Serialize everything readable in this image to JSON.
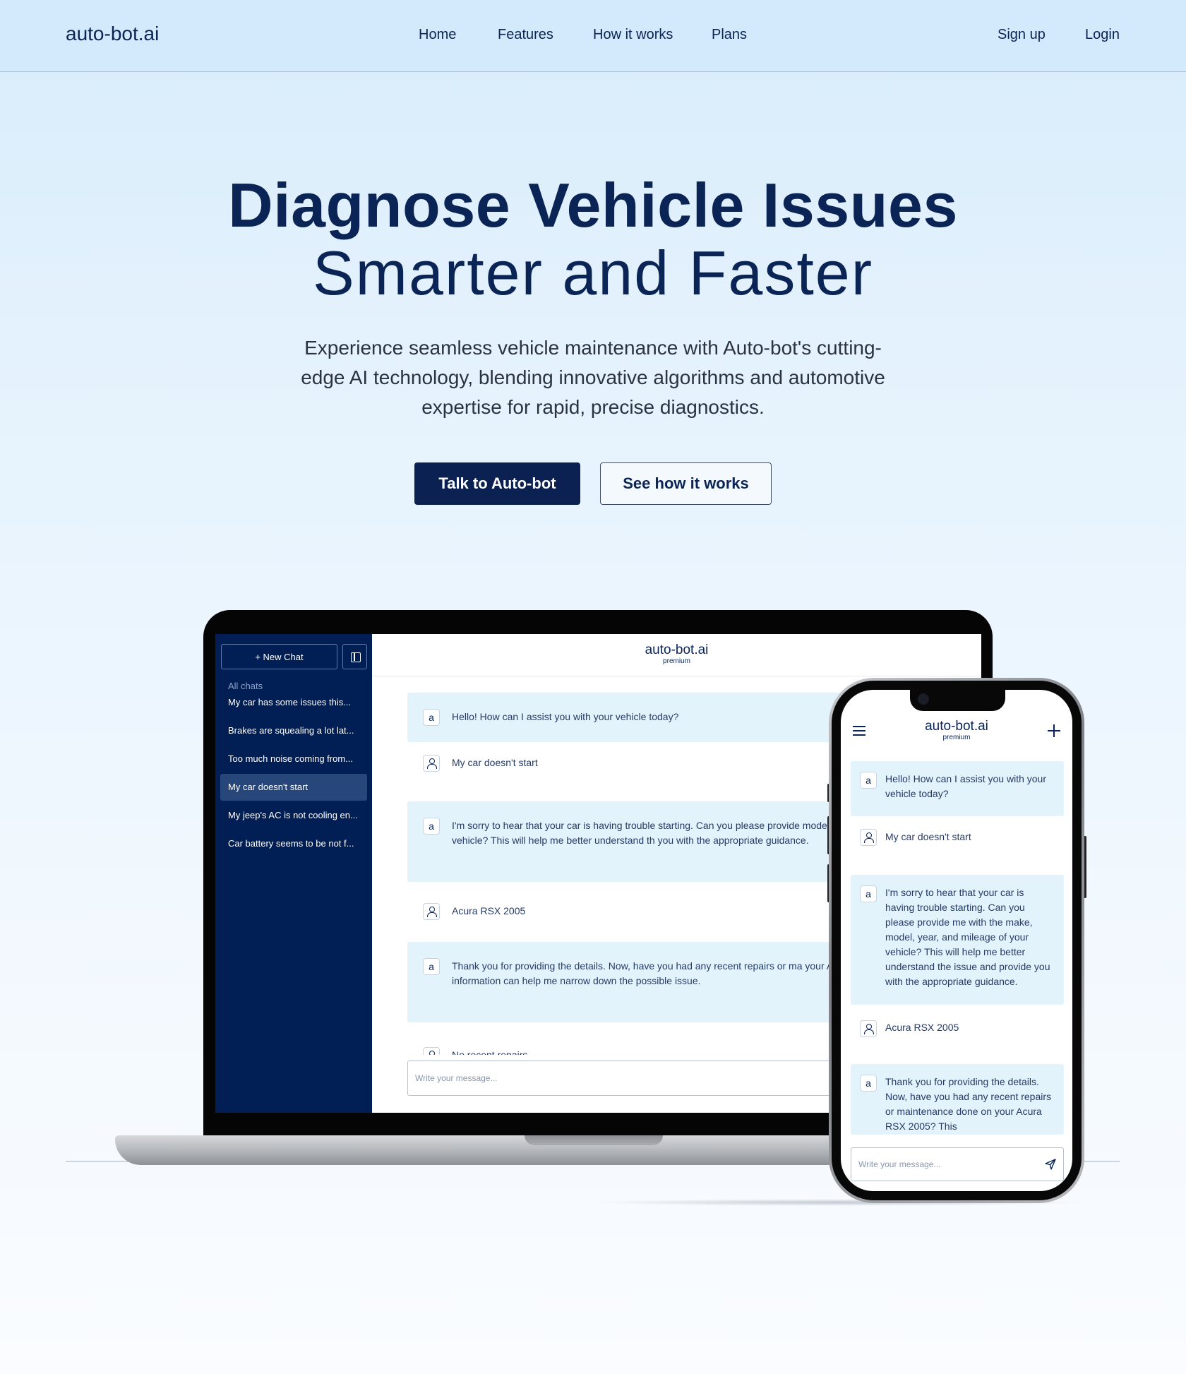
{
  "nav": {
    "logo": "auto-bot.ai",
    "links": [
      "Home",
      "Features",
      "How it works",
      "Plans"
    ],
    "sign_up": "Sign up",
    "login": "Login"
  },
  "hero": {
    "title_line1": "Diagnose Vehicle Issues",
    "title_line2": "Smarter and Faster",
    "subtitle": "Experience seamless vehicle maintenance with Auto-bot's cutting-edge AI technology, blending innovative algorithms and automotive expertise for rapid, precise diagnostics.",
    "primary_button": "Talk to Auto-bot",
    "secondary_button": "See how it works"
  },
  "laptop": {
    "sidebar": {
      "new_chat": "+ New Chat",
      "all_chats_label": "All chats",
      "chats": [
        "My car has some issues this...",
        "Brakes are squealing a lot lat...",
        "Too much noise coming from...",
        "My car doesn't start",
        "My jeep's AC is not cooling en...",
        "Car battery seems to be not f..."
      ],
      "active_chat": "My car doesn't start"
    },
    "header": {
      "brand": "auto-bot.ai",
      "tier": "premium"
    },
    "messages": [
      {
        "role": "bot",
        "text": "Hello! How can I assist you with your vehicle today?"
      },
      {
        "role": "user",
        "text": "My car doesn't start"
      },
      {
        "role": "bot",
        "text": "I'm sorry to hear that your car is having trouble starting. Can you please provide model, year, and mileage of your vehicle? This will help me better understand th you with the appropriate guidance."
      },
      {
        "role": "user",
        "text": "Acura RSX 2005"
      },
      {
        "role": "bot",
        "text": "Thank you for providing the details. Now, have you had any recent repairs or ma your Acura RSX 2005? This information can help me narrow down the possible issue."
      },
      {
        "role": "user",
        "text": "No recent repairs"
      }
    ],
    "input_placeholder": "Write your message..."
  },
  "phone": {
    "header": {
      "brand": "auto-bot.ai",
      "tier": "premium"
    },
    "messages": [
      {
        "role": "bot",
        "text": "Hello! How can I assist you with your vehicle today?"
      },
      {
        "role": "user",
        "text": "My car doesn't start"
      },
      {
        "role": "bot",
        "text": "I'm sorry to hear that your car is having trouble starting. Can you please provide me with the make, model, year, and mileage of your vehicle? This will help me better understand the issue and provide you with the appropriate guidance."
      },
      {
        "role": "user",
        "text": "Acura RSX 2005"
      },
      {
        "role": "bot",
        "text": "Thank you for providing the details. Now, have you had any recent repairs or maintenance done on your Acura RSX 2005? This"
      }
    ],
    "input_placeholder": "Write your message..."
  },
  "icons": {
    "bot_avatar": "a",
    "user_avatar": "user-icon",
    "send": "send-icon",
    "menu": "menu-icon",
    "plus": "plus-icon",
    "panel_toggle": "sidebar-toggle-icon"
  },
  "colors": {
    "brand_navy": "#0b2152",
    "sidebar_bg": "#021f55",
    "bot_bubble": "#e3f3fc",
    "nav_bg": "#d3eafc"
  }
}
